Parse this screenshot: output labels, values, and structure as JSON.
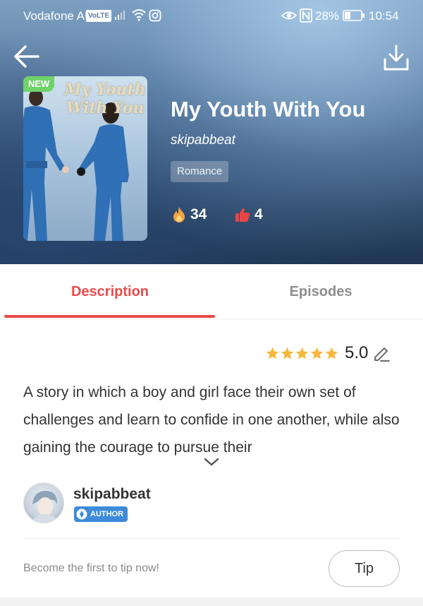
{
  "status_bar": {
    "carrier": "Vodafone AU",
    "volte_badge": "VoLTE",
    "battery_percent": "28%",
    "time": "10:54"
  },
  "header": {
    "back_icon": "arrow-left-icon",
    "download_icon": "download-icon"
  },
  "book": {
    "badge": "NEW",
    "cover_title": "My Youth With You",
    "title": "My Youth With You",
    "author": "skipabbeat",
    "genre": "Romance",
    "fire_count": "34",
    "like_count": "4"
  },
  "tabs": [
    {
      "label": "Description",
      "active": true
    },
    {
      "label": "Episodes",
      "active": false
    }
  ],
  "rating": {
    "value": "5.0",
    "stars": 5
  },
  "description": {
    "text": "A story in which a boy and girl face their own set of challenges and learn to confide in one another, while also gaining the courage to pursue their"
  },
  "author_section": {
    "name": "skipabbeat",
    "badge": "AUTHOR"
  },
  "tip": {
    "prompt": "Become the first to tip now!",
    "button_label": "Tip"
  },
  "colors": {
    "accent": "#ea4b4b",
    "star": "#f6b73c",
    "badge_new": "#6fd36a",
    "author_badge": "#3d8bd9"
  }
}
